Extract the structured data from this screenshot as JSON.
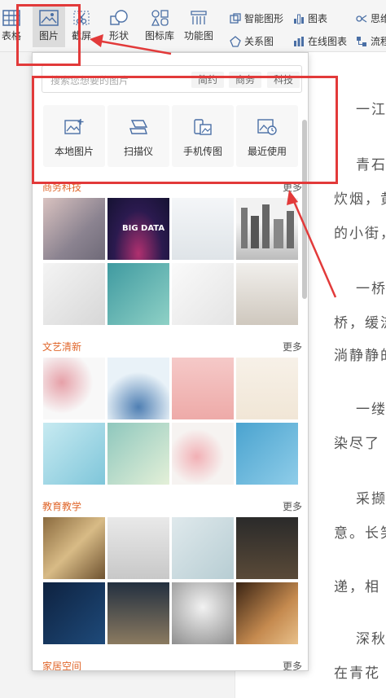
{
  "ribbon": {
    "table": "表格",
    "image": "图片",
    "screenshot": "截屏",
    "shape": "形状",
    "icon_lib": "图标库",
    "func_chart": "功能图",
    "smart_shape": "智能图形",
    "relation_chart": "关系图",
    "chart": "图表",
    "online_chart": "在线图表",
    "mind_map": "思维",
    "flow_chart": "流程"
  },
  "panel": {
    "search_placeholder": "搜索您想要的图片",
    "tags": [
      "简约",
      "商务",
      "科技"
    ],
    "sources": [
      {
        "label": "本地图片",
        "icon": "local-image-icon"
      },
      {
        "label": "扫描仪",
        "icon": "scanner-icon"
      },
      {
        "label": "手机传图",
        "icon": "phone-transfer-icon"
      },
      {
        "label": "最近使用",
        "icon": "recent-icon"
      }
    ],
    "more_label": "更多",
    "categories": [
      {
        "title": "商务科技"
      },
      {
        "title": "文艺清新"
      },
      {
        "title": "教育教学"
      },
      {
        "title": "家居空间"
      }
    ]
  },
  "document": {
    "lines": [
      "一江",
      "青石",
      "炊烟，黄",
      "的小街，",
      "一桥",
      "桥，缓流",
      "淌静静的",
      "一缕",
      "染尽了",
      "采撷",
      "意。长笑",
      "递，相",
      "深秋",
      "在青花"
    ]
  },
  "colors": {
    "accent": "#e0672c",
    "annotation": "#e23a3a"
  }
}
